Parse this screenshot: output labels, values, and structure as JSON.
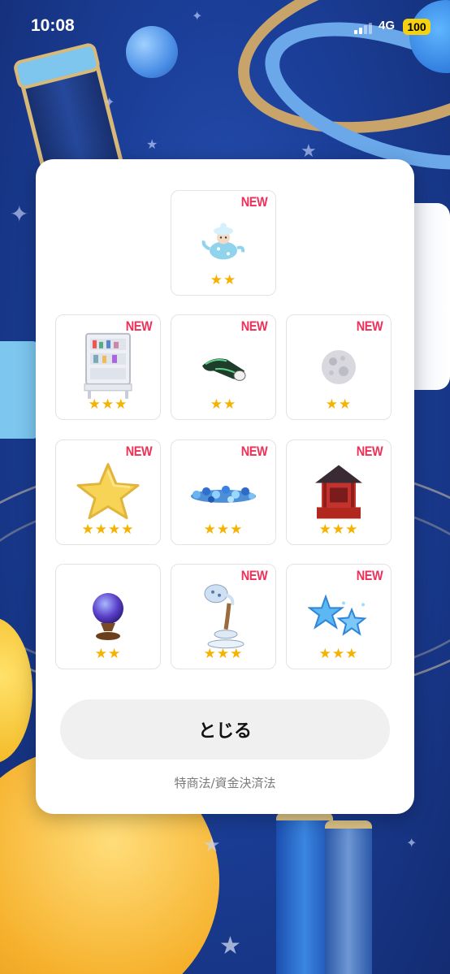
{
  "status_bar": {
    "time": "10:08",
    "network": "4G",
    "battery": "100"
  },
  "items": [
    {
      "name": "teapot-fairy",
      "new_label": "NEW",
      "stars": "★★"
    },
    {
      "name": "cabinet",
      "new_label": "NEW",
      "stars": "★★★"
    },
    {
      "name": "green-scarf",
      "new_label": "NEW",
      "stars": "★★"
    },
    {
      "name": "full-moon",
      "new_label": "NEW",
      "stars": "★★"
    },
    {
      "name": "star-cushion",
      "new_label": "NEW",
      "stars": "★★★★"
    },
    {
      "name": "flower-garland",
      "new_label": "NEW",
      "stars": "★★★"
    },
    {
      "name": "red-shrine",
      "new_label": "NEW",
      "stars": "★★★"
    },
    {
      "name": "crystal-ball",
      "new_label": "",
      "stars": "★★"
    },
    {
      "name": "floating-teapot",
      "new_label": "NEW",
      "stars": "★★★"
    },
    {
      "name": "blue-stars",
      "new_label": "NEW",
      "stars": "★★★"
    }
  ],
  "close_button": "とじる",
  "legal_link": "特商法/資金決済法",
  "colors": {
    "new": "#ee2f58",
    "stars": "#f6b200"
  }
}
